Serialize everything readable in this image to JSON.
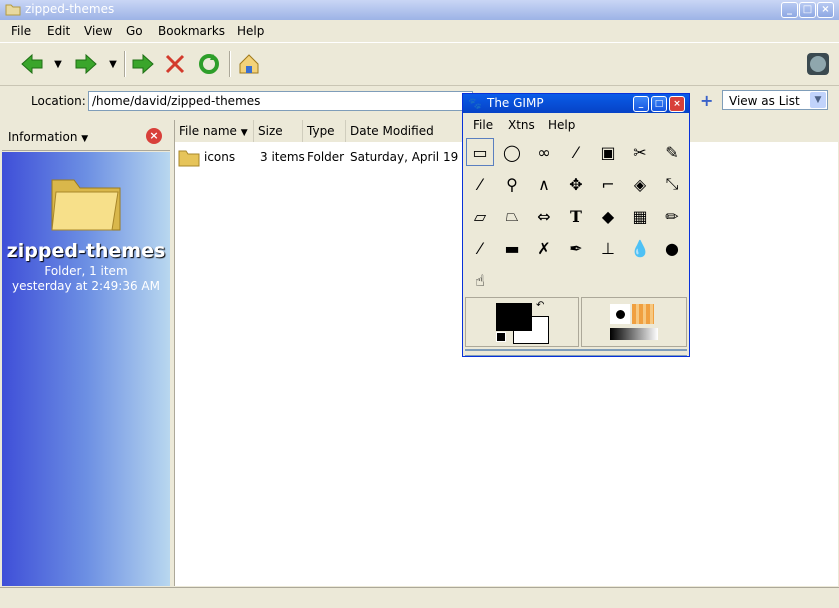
{
  "window": {
    "title": "zipped-themes"
  },
  "menubar": [
    "File",
    "Edit",
    "View",
    "Go",
    "Bookmarks",
    "Help"
  ],
  "location": {
    "label": "Location:",
    "value": "/home/david/zipped-themes"
  },
  "view_selector": {
    "value": "View as List"
  },
  "sidepane": {
    "header": "Information",
    "folder_name": "zipped-themes",
    "folder_info": "Folder, 1 item",
    "modified": "yesterday at 2:49:36 AM"
  },
  "columns": [
    "File name",
    "Size",
    "Type",
    "Date Modified"
  ],
  "files": [
    {
      "name": "icons",
      "size": "3 items",
      "type": "Folder",
      "date": "Saturday, April 19 20"
    }
  ],
  "gimp": {
    "title": "The GIMP",
    "menu": [
      "File",
      "Xtns",
      "Help"
    ]
  }
}
